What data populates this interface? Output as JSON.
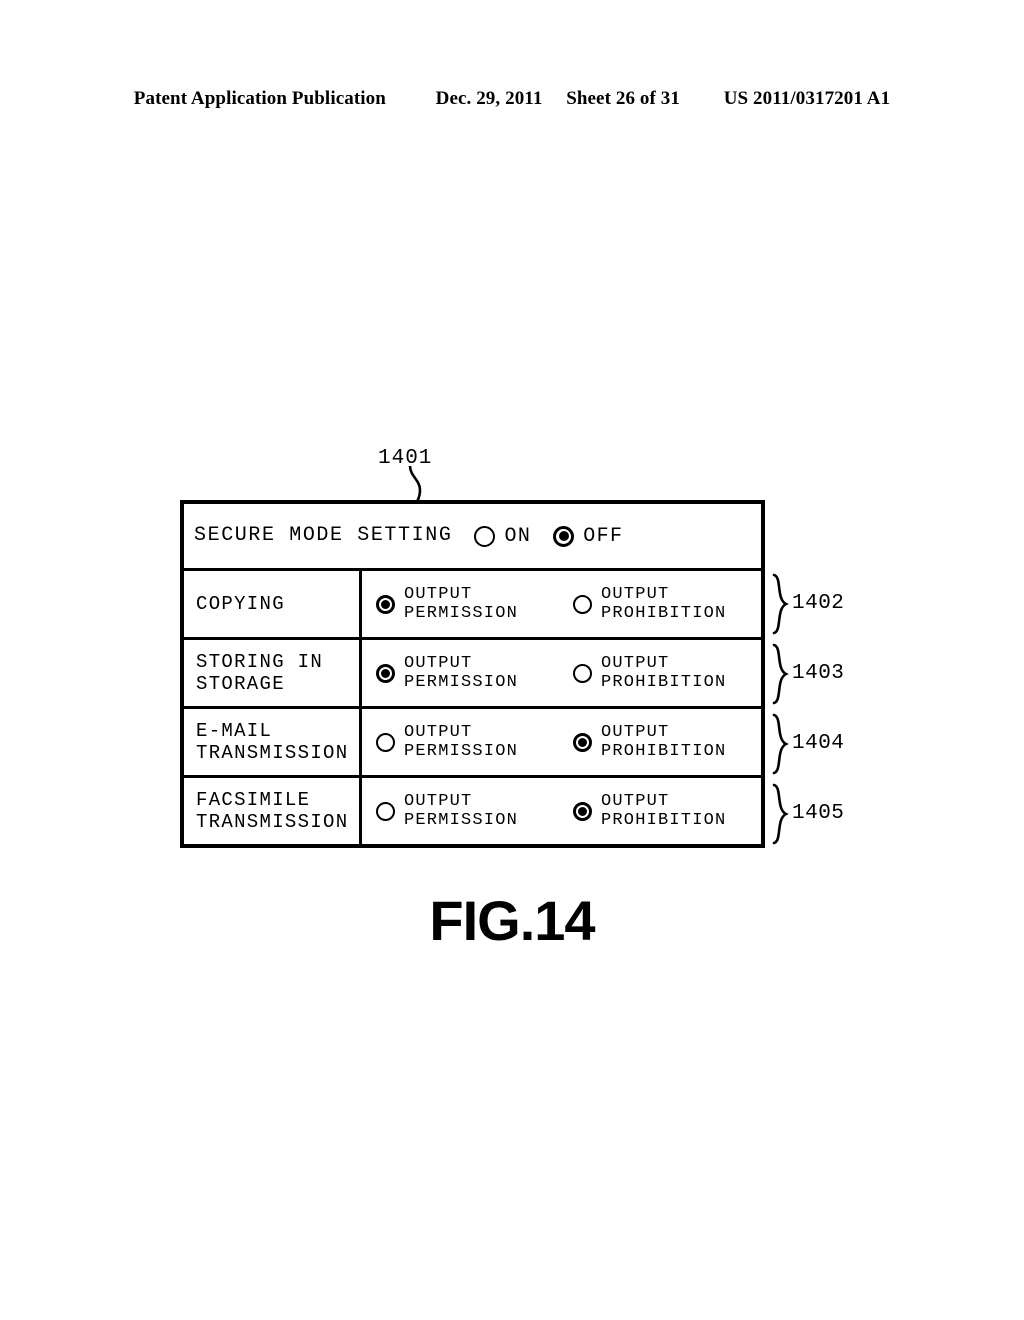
{
  "page_header": {
    "publication": "Patent Application Publication",
    "date": "Dec. 29, 2011",
    "sheet": "Sheet 26 of 31",
    "patent_number": "US 2011/0317201 A1"
  },
  "figure": {
    "caption": "FIG.14",
    "panel_ref": "1401",
    "secure_mode": {
      "title": "SECURE MODE SETTING",
      "options": [
        {
          "label": "ON",
          "selected": false
        },
        {
          "label": "OFF",
          "selected": true
        }
      ]
    },
    "option_labels": {
      "permission": "OUTPUT\nPERMISSION",
      "prohibition": "OUTPUT\nPROHIBITION"
    },
    "rows": [
      {
        "ref": "1402",
        "name": "COPYING",
        "permission_selected": true,
        "prohibition_selected": false
      },
      {
        "ref": "1403",
        "name": "STORING IN\nSTORAGE",
        "permission_selected": true,
        "prohibition_selected": false
      },
      {
        "ref": "1404",
        "name": "E-MAIL\nTRANSMISSION",
        "permission_selected": false,
        "prohibition_selected": true
      },
      {
        "ref": "1405",
        "name": "FACSIMILE\nTRANSMISSION",
        "permission_selected": false,
        "prohibition_selected": true
      }
    ]
  },
  "colors": {
    "ink": "#000000",
    "paper": "#ffffff"
  }
}
